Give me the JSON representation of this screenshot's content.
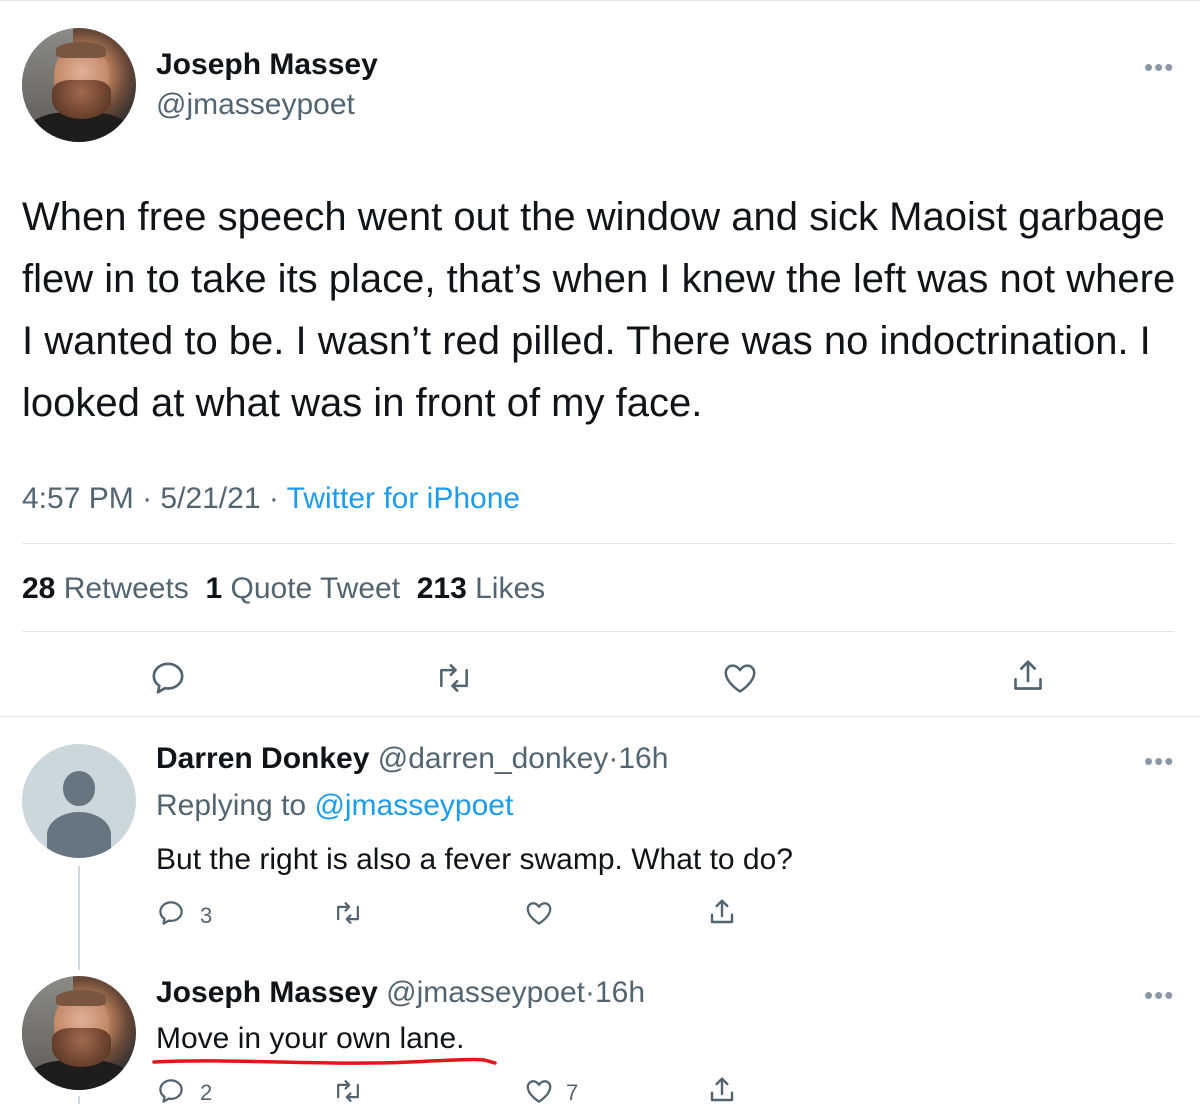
{
  "main_tweet": {
    "author_name": "Joseph Massey",
    "author_handle": "@jmasseypoet",
    "text": "When free speech went out the window and sick Maoist garbage flew in to take its place, that’s when I knew the left was not where I wanted to be. I wasn’t red pilled. There was no indoctrination. I looked at what was in front of my face.",
    "time": "4:57 PM",
    "date": "5/21/21",
    "source": "Twitter for iPhone",
    "retweets_count": "28",
    "retweets_label": "Retweets",
    "quote_count": "1",
    "quote_label": "Quote Tweet",
    "likes_count": "213",
    "likes_label": "Likes",
    "more_icon": "more-horizontal-icon"
  },
  "replies": [
    {
      "author_name": "Darren Donkey",
      "author_handle": "@darren_donkey",
      "age": "16h",
      "replying_prefix": "Replying to",
      "replying_to": "@jmasseypoet",
      "text": "But the right is also a fever swamp. What to do?",
      "reply_count": "3",
      "retweet_count": "",
      "like_count": ""
    },
    {
      "author_name": "Joseph Massey",
      "author_handle": "@jmasseypoet",
      "age": "16h",
      "text": "Move in your own lane.",
      "reply_count": "2",
      "retweet_count": "",
      "like_count": "7"
    }
  ],
  "separator": "·",
  "colors": {
    "text": "#0f1419",
    "secondary": "#536471",
    "link": "#1d9bf0",
    "annotation_underline": "#e3161c"
  },
  "icons": [
    "reply-icon",
    "retweet-icon",
    "like-icon",
    "share-icon",
    "more-horizontal-icon"
  ]
}
